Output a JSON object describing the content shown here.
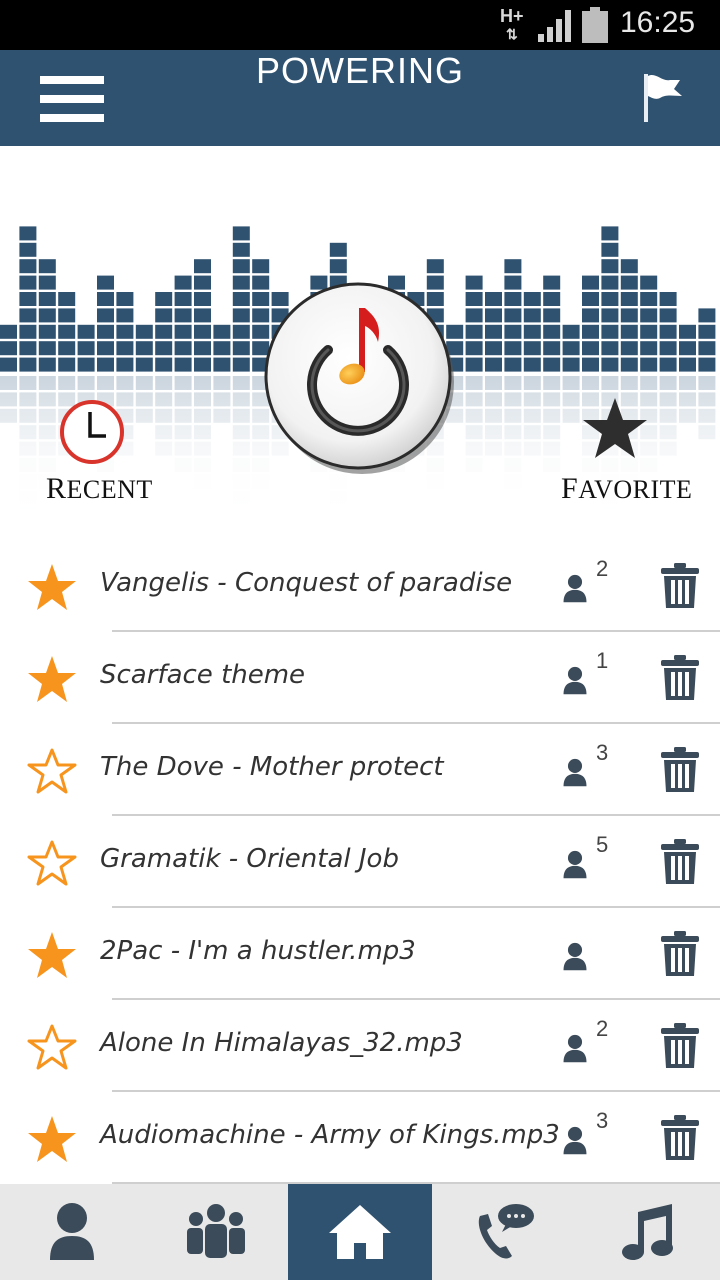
{
  "status_bar": {
    "network": "H+",
    "time": "16:25"
  },
  "app_bar": {
    "title": "POWERING"
  },
  "hero": {
    "recent": {
      "first": "R",
      "rest": "ECENT"
    },
    "favorite": {
      "first": "F",
      "rest": "AVORITE"
    }
  },
  "tracks": [
    {
      "title": "Vangelis - Conquest of paradise",
      "favorite": true,
      "listeners": "2"
    },
    {
      "title": "Scarface theme",
      "favorite": true,
      "listeners": "1"
    },
    {
      "title": "The Dove - Mother protect",
      "favorite": false,
      "listeners": "3"
    },
    {
      "title": "Gramatik - Oriental Job",
      "favorite": false,
      "listeners": "5"
    },
    {
      "title": "2Pac - I'm a hustler.mp3",
      "favorite": true,
      "listeners": ""
    },
    {
      "title": "Alone In Himalayas_32.mp3",
      "favorite": false,
      "listeners": "2"
    },
    {
      "title": "Audiomachine - Army of Kings.mp3",
      "favorite": true,
      "listeners": "3"
    }
  ],
  "bottom_nav": [
    {
      "icon": "user-icon"
    },
    {
      "icon": "group-icon"
    },
    {
      "icon": "home-icon",
      "active": true
    },
    {
      "icon": "phone-chat-icon"
    },
    {
      "icon": "music-note-icon"
    }
  ],
  "colors": {
    "primary": "#2f5270",
    "star_orange": "#f7941d",
    "text_dark": "#333333"
  }
}
